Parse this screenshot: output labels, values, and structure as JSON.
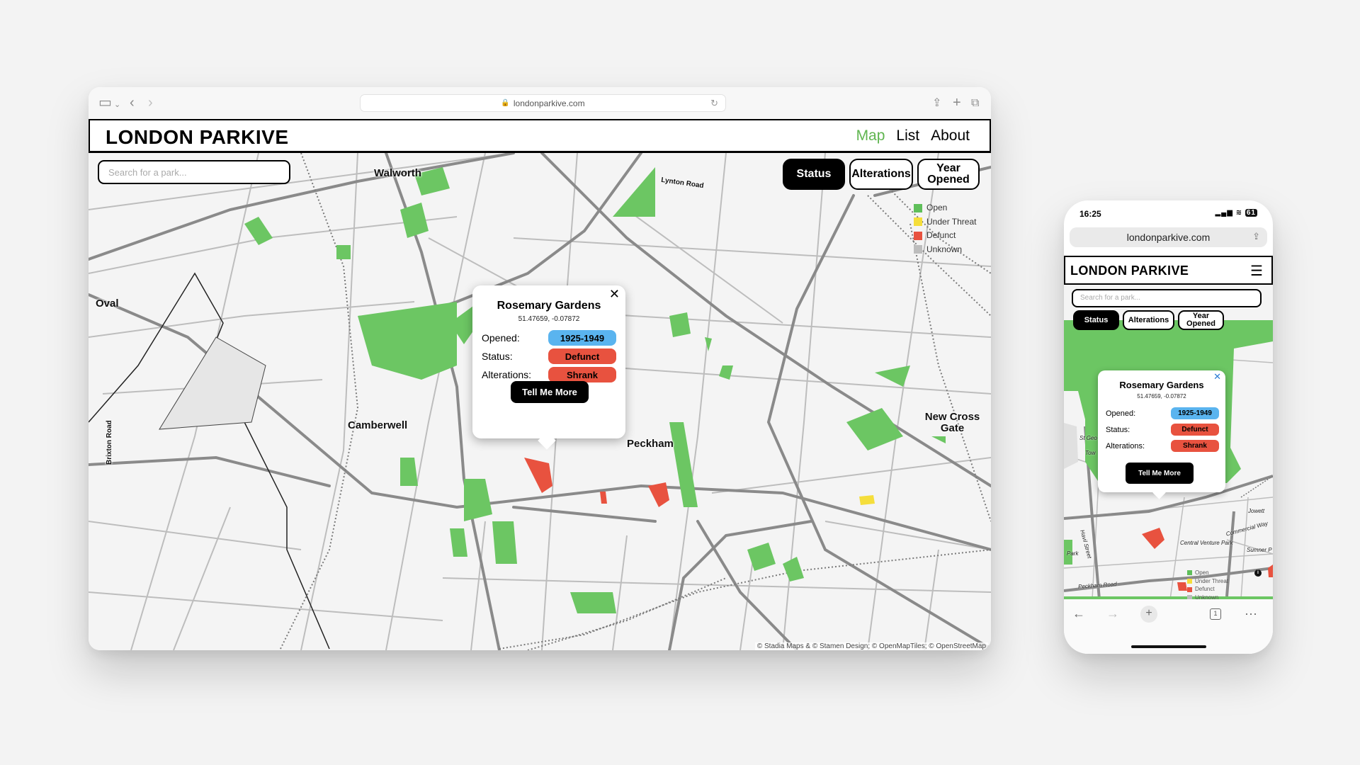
{
  "site": {
    "logo": "LONDON PARKIVE",
    "nav": [
      "Map",
      "List",
      "About"
    ],
    "active_nav": "Map",
    "search_placeholder": "Search for a park...",
    "filters": [
      "Status",
      "Alterations",
      "Year Opened"
    ],
    "active_filter": "Status"
  },
  "desktop_browser": {
    "url": "londonparkive.com"
  },
  "legend": [
    {
      "label": "Open",
      "color": "#5fbf5a"
    },
    {
      "label": "Under Threat",
      "color": "#f5de3b"
    },
    {
      "label": "Defunct",
      "color": "#e8523f"
    },
    {
      "label": "Unknown",
      "color": "#bdbdbd"
    }
  ],
  "map_labels": {
    "walworth": "Walworth",
    "lynton_road": "Lynton Road",
    "oval": "Oval",
    "camberwell": "Camberwell",
    "peckham": "Peckham",
    "new_cross_gate": "New Cross Gate",
    "brixton_road": "Brixton Road"
  },
  "attribution": "© Stadia Maps & © Stamen Design; © OpenMapTiles; © OpenStreetMap",
  "popup": {
    "name": "Rosemary Gardens",
    "coords": "51.47659, -0.07872",
    "opened_label": "Opened:",
    "opened_value": "1925-1949",
    "status_label": "Status:",
    "status_value": "Defunct",
    "alterations_label": "Alterations:",
    "alterations_value": "Shrank",
    "button": "Tell Me More"
  },
  "phone": {
    "time": "16:25",
    "battery": "61",
    "url": "londonparkive.com",
    "tabs_count": "1",
    "map_labels": {
      "st_geo": "St Geo",
      "tow": "Tow",
      "jowett": "Jowett",
      "commercial_way": "Commercial Way",
      "central_venture_park": "Central Venture Park",
      "sumner": "Sumner P",
      "havil_street": "Havil Street",
      "park": "Park",
      "peckham_road": "Peckham Road"
    }
  },
  "colors": {
    "accent_green": "#5fb54f",
    "park_green": "#6cc663",
    "chip_blue": "#5ab4ef",
    "chip_red": "#e8523f"
  }
}
